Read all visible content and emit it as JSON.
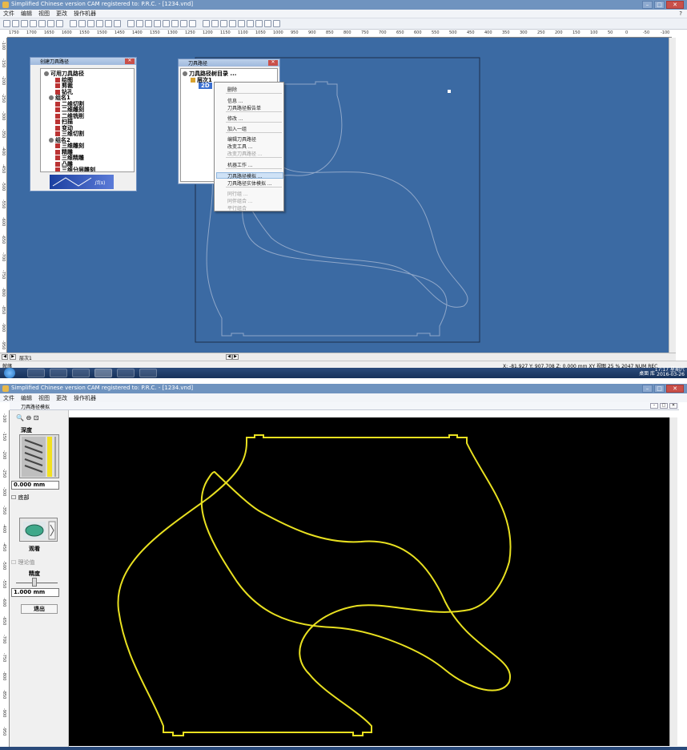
{
  "top": {
    "window_title": "Simplified Chinese  version  CAM registered to: P.R.C. - [1234.vnd]",
    "menu": [
      "文件",
      "编辑",
      "视图",
      "更改",
      "操作机器"
    ],
    "menu_help": "?",
    "ruler_ticks": [
      "1750",
      "1700",
      "1650",
      "1600",
      "1550",
      "1500",
      "1450",
      "1400",
      "1350",
      "1300",
      "1250",
      "1200",
      "1150",
      "1100",
      "1050",
      "1000",
      "950",
      "900",
      "850",
      "800",
      "750",
      "700",
      "650",
      "600",
      "550",
      "500",
      "450",
      "400",
      "350",
      "300",
      "250",
      "200",
      "150",
      "100",
      "50",
      "0",
      "-50",
      "-100"
    ],
    "vruler_ticks": [
      "-100",
      "-150",
      "-200",
      "-250",
      "-300",
      "-350",
      "-400",
      "-450",
      "-500",
      "-550",
      "-600",
      "-650",
      "-700",
      "-750",
      "-800",
      "-850",
      "-900",
      "-950"
    ],
    "create_dialog": {
      "title": "创建刀具路径",
      "tree": [
        "可用刀具路径",
        "绘图",
        "剪裁",
        "钻孔",
        "组名1",
        "二维切割",
        "二维雕刻",
        "二维铣削",
        "扫描",
        "变动",
        "三维切割",
        "组名2",
        "三维雕刻",
        "精雕",
        "三维精雕",
        "凸雕",
        "三维分层雕刻"
      ]
    },
    "path_dialog": {
      "title": "刀具路径",
      "root": "刀具路径树目录 ...",
      "layer": "层次1",
      "selected_item": "2D"
    },
    "context_menu": {
      "items": [
        "删除",
        "信息 ...",
        "刀具路径报告单",
        "修改 ...",
        "加入一组",
        "编辑刀具路径",
        "改变工具 ...",
        "改变刀具路径 ...",
        "机器工作 ...",
        "刀具路径模拟 ...",
        "刀具路径实体模拟 ...",
        "同行组 ...",
        "同伴组合 ...",
        "平行组合"
      ],
      "disabled": [
        7,
        11,
        12,
        13
      ],
      "highlighted_index": 9
    },
    "hscroll_label": "层次1",
    "status_left": "就绪",
    "status_coords": "X: -81.927  Y: 907.708  Z: 0.000 mm       XY 视图   25 % 2047  NUM  REC",
    "tray": "桌面  库",
    "clock_time": "17:17 星期六",
    "clock_date": "2016-03-26"
  },
  "bottom": {
    "window_title": "Simplified Chinese  version  CAM registered to: P.R.C. - [1234.vnd]",
    "menu": [
      "文件",
      "编辑",
      "视图",
      "更改",
      "操作机器"
    ],
    "doc_title": "刀具路径模拟",
    "panel": {
      "depth_label": "深度",
      "depth_value": "0.000 mm",
      "bottom_check": "底部",
      "view_label": "观看",
      "theory_check": "理论值",
      "precision_label": "精度",
      "precision_value": "1.000 mm",
      "exit_button": "退出"
    },
    "colors": {
      "toolpath": "#e8e020",
      "sim_background": "#000000",
      "desktop_blue": "#3b6aa3"
    }
  }
}
